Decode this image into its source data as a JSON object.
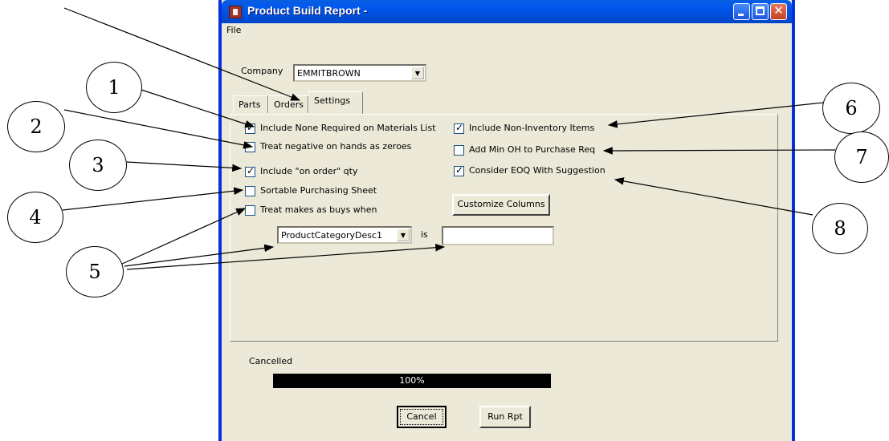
{
  "window": {
    "title": "Product Build Report -",
    "menu": [
      "File"
    ]
  },
  "company": {
    "label": "Company",
    "value": "EMMITBROWN"
  },
  "tabs": [
    {
      "label": "Parts"
    },
    {
      "label": "Orders"
    },
    {
      "label": "Settings",
      "active": true
    }
  ],
  "settings": {
    "left": [
      {
        "label": "Include None Required on Materials List",
        "checked": true
      },
      {
        "label": "Treat negative on hands as zeroes",
        "checked": false
      },
      {
        "label": "Include \"on order\" qty",
        "checked": true
      },
      {
        "label": "Sortable Purchasing Sheet",
        "checked": false
      },
      {
        "label": "Treat makes as buys when",
        "checked": false
      }
    ],
    "right": [
      {
        "label": "Include Non-Inventory Items",
        "checked": true
      },
      {
        "label": "Add Min OH to Purchase Req",
        "checked": false
      },
      {
        "label": "Consider EOQ With Suggestion",
        "checked": true
      }
    ],
    "customize_button": "Customize Columns",
    "condition_field": "ProductCategoryDesc1",
    "condition_word": "is",
    "condition_value": ""
  },
  "status": {
    "text": "Cancelled",
    "progress_label": "100%",
    "progress": 1.0
  },
  "buttons": {
    "cancel": "Cancel",
    "run": "Run Rpt"
  },
  "callouts": [
    "1",
    "2",
    "3",
    "4",
    "5",
    "6",
    "7",
    "8"
  ],
  "colors": {
    "title_bar": "#0055e5",
    "window_bg": "#ece9d8",
    "progress_bar": "#000000"
  }
}
